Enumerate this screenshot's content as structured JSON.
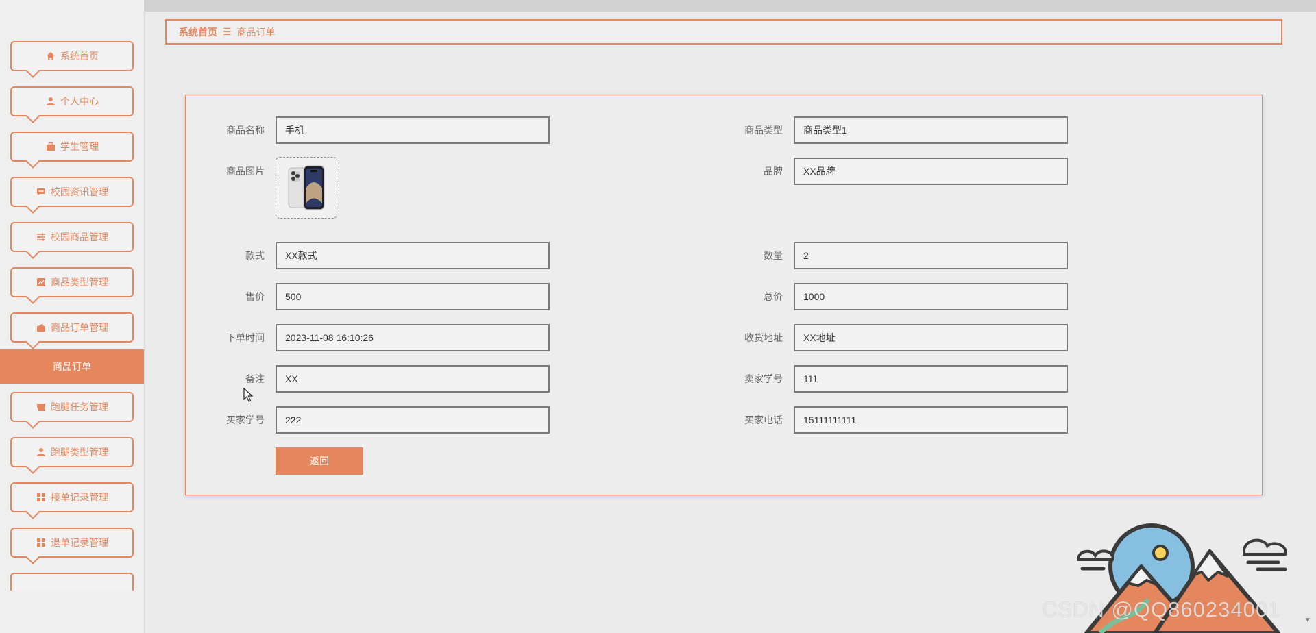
{
  "sidebar": {
    "items": [
      {
        "label": "系统首页",
        "icon": "home-icon"
      },
      {
        "label": "个人中心",
        "icon": "user-icon"
      },
      {
        "label": "学生管理",
        "icon": "briefcase-icon"
      },
      {
        "label": "校园资讯管理",
        "icon": "chat-icon"
      },
      {
        "label": "校园商品管理",
        "icon": "sliders-icon"
      },
      {
        "label": "商品类型管理",
        "icon": "chart-icon"
      },
      {
        "label": "商品订单管理",
        "icon": "wallet-icon"
      },
      {
        "label": "跑腿任务管理",
        "icon": "store-icon"
      },
      {
        "label": "跑腿类型管理",
        "icon": "person-icon"
      },
      {
        "label": "接单记录管理",
        "icon": "grid-icon"
      },
      {
        "label": "退单记录管理",
        "icon": "grid-icon"
      }
    ],
    "active_sub": "商品订单"
  },
  "breadcrumb": {
    "home": "系统首页",
    "separator": "☰",
    "current": "商品订单"
  },
  "form": {
    "product_name": {
      "label": "商品名称",
      "value": "手机"
    },
    "product_type": {
      "label": "商品类型",
      "value": "商品类型1"
    },
    "product_image": {
      "label": "商品图片",
      "icon": "phone-image"
    },
    "brand": {
      "label": "品牌",
      "value": "XX品牌"
    },
    "style": {
      "label": "款式",
      "value": "XX款式"
    },
    "quantity": {
      "label": "数量",
      "value": "2"
    },
    "price": {
      "label": "售价",
      "value": "500"
    },
    "total": {
      "label": "总价",
      "value": "1000"
    },
    "order_time": {
      "label": "下单时间",
      "value": "2023-11-08 16:10:26"
    },
    "address": {
      "label": "收货地址",
      "value": "XX地址"
    },
    "remark": {
      "label": "备注",
      "value": "XX"
    },
    "seller_id": {
      "label": "卖家学号",
      "value": "111"
    },
    "buyer_id": {
      "label": "买家学号",
      "value": "222"
    },
    "buyer_phone": {
      "label": "买家电话",
      "value": "15111111111"
    },
    "back_label": "返回"
  },
  "watermark": "CSDN @QQ860234001",
  "colors": {
    "accent": "#e5875e",
    "background": "#ebebeb",
    "input_border": "#7a7a7a"
  }
}
